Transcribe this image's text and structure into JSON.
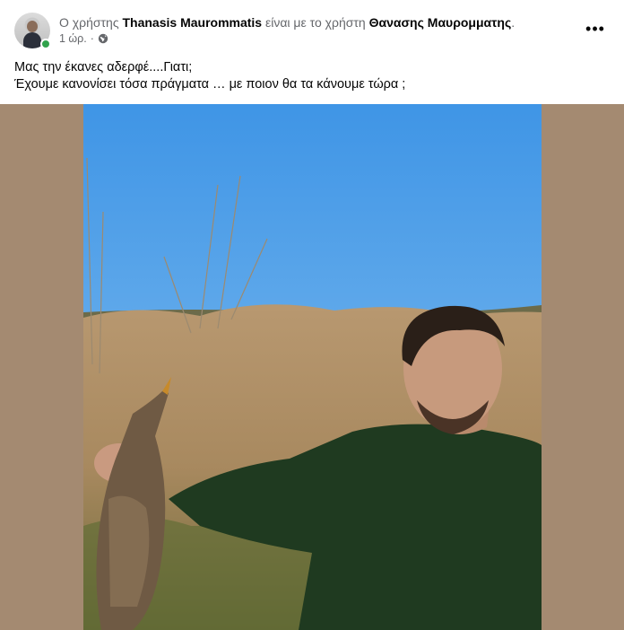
{
  "post": {
    "prefix": "Ο χρήστης",
    "author": "Thanasis Maurommatis",
    "connector": "είναι με το χρήστη",
    "tagged": "Θανασης Μαυρομματης",
    "end": ".",
    "time": "1 ώρ.",
    "separator": "·",
    "privacy_icon": "globe-icon",
    "more_icon": "more-options-icon",
    "text_line_1": "Μας την έκανες αδερφέ....Γιατι;",
    "text_line_2": "Έχουμε κανονίσει τόσα πράγματα … με ποιον θα τα κάνουμε τώρα ;"
  },
  "colors": {
    "frame_background": "#a48a71",
    "online": "#31a24c",
    "muted_text": "#65676b"
  }
}
